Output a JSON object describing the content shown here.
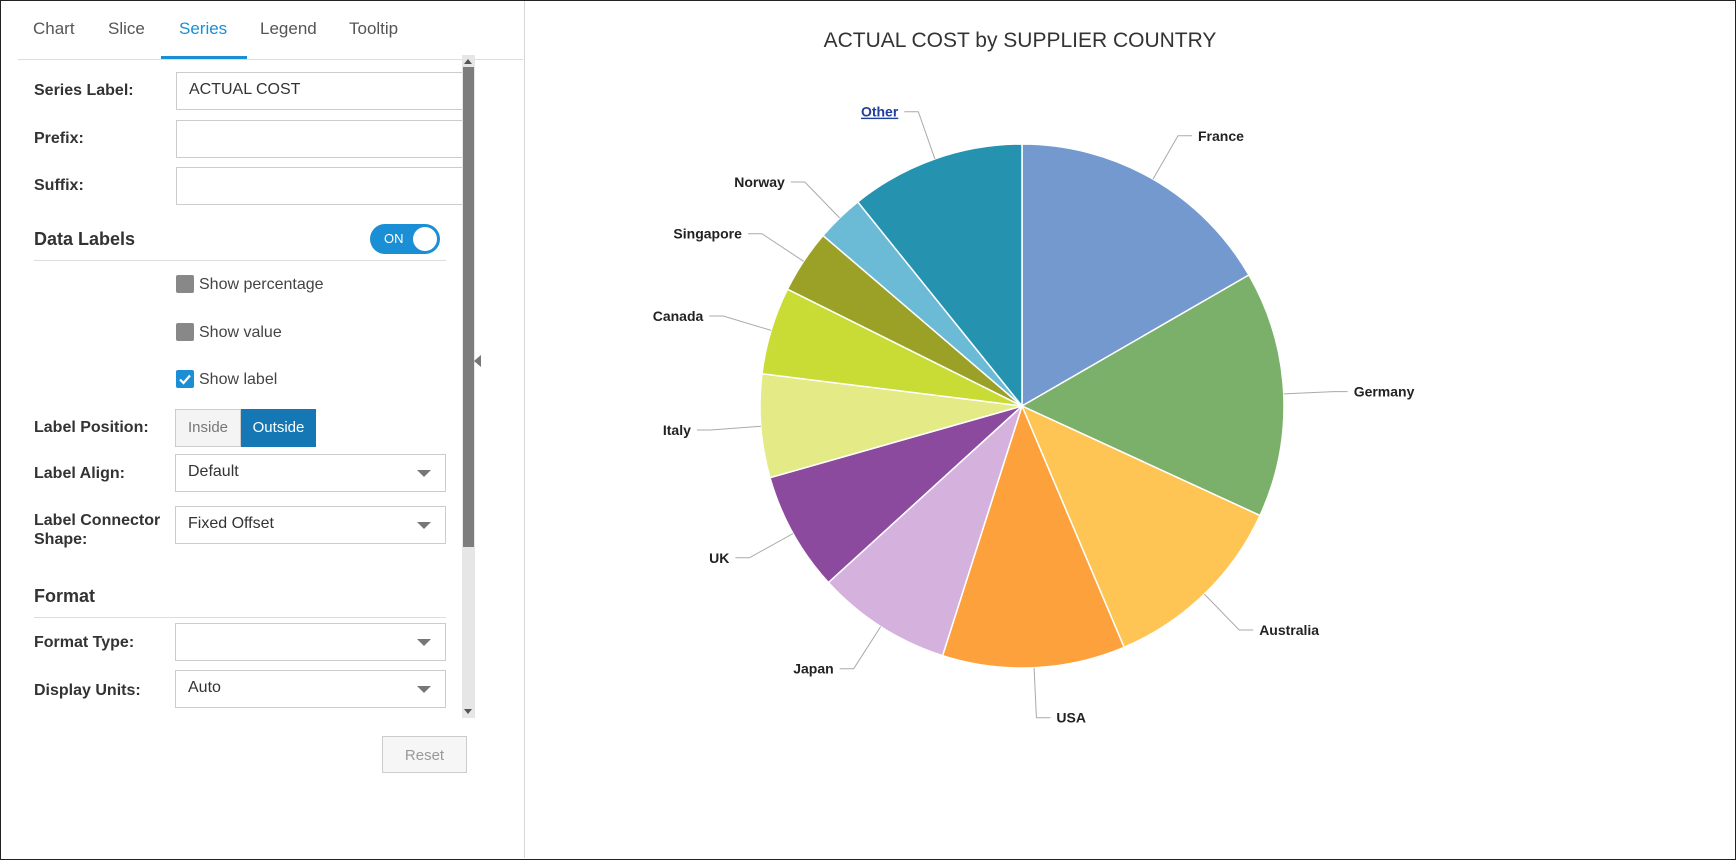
{
  "tabs": [
    "Chart",
    "Slice",
    "Series",
    "Legend",
    "Tooltip"
  ],
  "active_tab": "Series",
  "form": {
    "series_label": {
      "label": "Series Label:",
      "value": "ACTUAL COST"
    },
    "prefix": {
      "label": "Prefix:",
      "value": ""
    },
    "suffix": {
      "label": "Suffix:",
      "value": ""
    },
    "data_labels": {
      "title": "Data Labels",
      "toggle": "ON"
    },
    "show_percentage": {
      "label": "Show percentage",
      "checked": false
    },
    "show_value": {
      "label": "Show value",
      "checked": false
    },
    "show_label": {
      "label": "Show label",
      "checked": true
    },
    "label_position": {
      "label": "Label Position:",
      "options": [
        "Inside",
        "Outside"
      ],
      "selected": "Outside"
    },
    "label_align": {
      "label": "Label Align:",
      "value": "Default"
    },
    "label_connector": {
      "label_line1": "Label Connector",
      "label_line2": "Shape:",
      "value": "Fixed Offset"
    },
    "format": {
      "title": "Format"
    },
    "format_type": {
      "label": "Format Type:",
      "value": ""
    },
    "display_units": {
      "label": "Display Units:",
      "value": "Auto"
    }
  },
  "reset_label": "Reset",
  "chart_data": {
    "type": "pie",
    "title": "ACTUAL COST by SUPPLIER COUNTRY",
    "slices": [
      {
        "label": "France",
        "value": 17.0,
        "color": "#7399cf"
      },
      {
        "label": "Germany",
        "value": 15.5,
        "color": "#7ab06a"
      },
      {
        "label": "Australia",
        "value": 12.0,
        "color": "#fec555"
      },
      {
        "label": "USA",
        "value": 11.5,
        "color": "#fca13b"
      },
      {
        "label": "Japan",
        "value": 8.5,
        "color": "#d5b2de"
      },
      {
        "label": "UK",
        "value": 7.5,
        "color": "#8c4a9e"
      },
      {
        "label": "Italy",
        "value": 6.5,
        "color": "#e4ea86"
      },
      {
        "label": "Canada",
        "value": 5.5,
        "color": "#c8dc35"
      },
      {
        "label": "Singapore",
        "value": 4.0,
        "color": "#9ba127"
      },
      {
        "label": "Norway",
        "value": 3.0,
        "color": "#6bbbd6"
      },
      {
        "label": "Other",
        "value": 11.0,
        "color": "#2592b0",
        "link": true
      }
    ],
    "legend": "none",
    "data_labels": "outside"
  }
}
